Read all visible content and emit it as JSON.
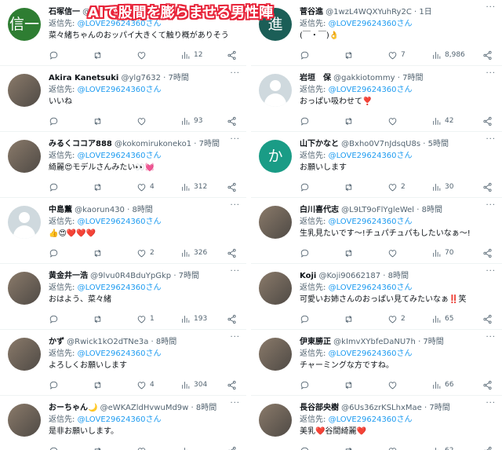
{
  "overlay_title": "AIで股間を膨らませる男性陣",
  "reply_prefix": "返信先: ",
  "reply_to": "@LOVE29624360さん",
  "left": [
    {
      "avatar": "信一",
      "avatar_color": "#2e7d32",
      "name": "石塚信一",
      "meta": " @...",
      "text": "菜々緒ちゃんのおッパイ大きくて触り概がありそう",
      "views": "12",
      "likes": "",
      "retweets": ""
    },
    {
      "avatar": "",
      "name": "Akira Kanetsuki",
      "meta": " @ylg7632 · 7時間",
      "text": "いいね",
      "views": "93",
      "likes": "",
      "retweets": ""
    },
    {
      "avatar": "",
      "name": "みるくココア888",
      "meta": " @kokomirukoneko1 · 7時間",
      "text": "綺麗😍モデルさんみたい👀💓",
      "views": "312",
      "likes": "4",
      "retweets": ""
    },
    {
      "avatar": "default",
      "name": "中島薫",
      "meta": " @kaorun430 · 8時間",
      "text": "👍😍❤️❤️❤️",
      "views": "326",
      "likes": "2",
      "retweets": ""
    },
    {
      "avatar": "",
      "name": "黄金井一浩",
      "meta": " @9lvu0R4BduYpGkp · 7時間",
      "text": "おはよう、菜々緒",
      "views": "193",
      "likes": "1",
      "retweets": ""
    },
    {
      "avatar": "",
      "name": "かず",
      "meta": " @Rwick1kO2dTNe3a · 8時間",
      "text": "よろしくお願いします",
      "views": "304",
      "likes": "4",
      "retweets": ""
    },
    {
      "avatar": "",
      "name": "おーちゃん🌙",
      "meta": " @eWKAZldHvwuMd9w · 8時間",
      "text": "是非お願いします。",
      "views": "",
      "likes": "",
      "retweets": ""
    }
  ],
  "right": [
    {
      "avatar": "進",
      "avatar_color": "#1b5e57",
      "name": "菅谷進",
      "meta": " @1wzL4WQXYuhRy2C · 1日",
      "text": "(￣・￣)👌",
      "views": "8,986",
      "likes": "7",
      "retweets": ""
    },
    {
      "avatar": "default",
      "name": "岩垣　保",
      "meta": " @gakkiotommy · 7時間",
      "text": "おっぱい吸わせて❣️",
      "views": "42",
      "likes": "",
      "retweets": ""
    },
    {
      "avatar": "か",
      "avatar_color": "#1a9c86",
      "name": "山下かなと",
      "meta": " @Bxho0V7nJdsqU8s · 5時間",
      "text": "お願いします",
      "views": "30",
      "likes": "2",
      "retweets": ""
    },
    {
      "avatar": "",
      "name": "白川喜代志",
      "meta": " @L9LT9oFlYgleWel · 8時間",
      "text": "生乳見たいです〜!チュパチュパもしたいなぁ〜!",
      "views": "70",
      "likes": "",
      "retweets": ""
    },
    {
      "avatar": "",
      "name": "Koji",
      "meta": " @Koji90662187 · 8時間",
      "text": "可愛いお姉さんのおっぱい見てみたいなぁ‼️笑",
      "views": "65",
      "likes": "2",
      "retweets": ""
    },
    {
      "avatar": "",
      "name": "伊東勝正",
      "meta": " @kImvXYbfeDaNU7h · 7時間",
      "text": "チャーミングな方ですね。",
      "views": "66",
      "likes": "",
      "retweets": ""
    },
    {
      "avatar": "",
      "name": "長谷部央樹",
      "meta": " @6Us36zrKSLhxMae · 7時間",
      "text": "美乳❤️谷間綺麗❤️",
      "views": "62",
      "likes": "",
      "retweets": ""
    }
  ],
  "icons": {
    "reply": "reply-icon",
    "retweet": "retweet-icon",
    "like": "heart-icon",
    "views": "views-icon",
    "share": "share-icon",
    "more": "more-icon"
  },
  "colors": {
    "link": "#1d9bf0",
    "overlay_fill": "#ffffff",
    "overlay_stroke": "#e8253a"
  }
}
